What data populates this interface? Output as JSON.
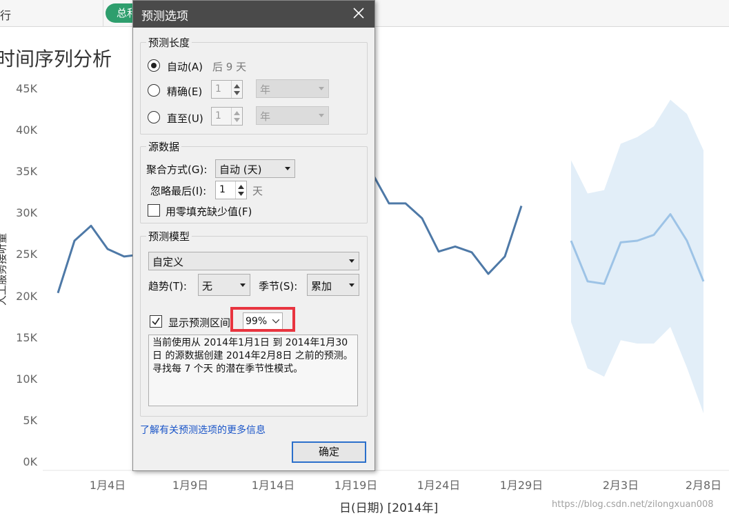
{
  "toolbar": {
    "rows_label": "行",
    "pill_label": "总和"
  },
  "chart_data": {
    "type": "line",
    "title": "时间序列分析",
    "ylabel": "人工服务接听量",
    "xlabel": "日(日期) [2014年]",
    "ylim": [
      0,
      45000
    ],
    "yticks": [
      "0K",
      "5K",
      "10K",
      "15K",
      "20K",
      "25K",
      "30K",
      "35K",
      "40K",
      "45K"
    ],
    "xticks": [
      {
        "label": "1月4日",
        "day": 4
      },
      {
        "label": "1月9日",
        "day": 9
      },
      {
        "label": "1月14日",
        "day": 14
      },
      {
        "label": "1月19日",
        "day": 19
      },
      {
        "label": "1月24日",
        "day": 24
      },
      {
        "label": "1月29日",
        "day": 29
      },
      {
        "label": "2月3日",
        "day": 35
      },
      {
        "label": "2月8日",
        "day": 40
      }
    ],
    "series": [
      {
        "role": "actual",
        "color": "#4e79a7",
        "points": [
          {
            "day": 1,
            "value": 20400
          },
          {
            "day": 2,
            "value": 26700
          },
          {
            "day": 3,
            "value": 28500
          },
          {
            "day": 4,
            "value": 25700
          },
          {
            "day": 5,
            "value": 24800
          },
          {
            "day": 18,
            "value": 28000
          },
          {
            "day": 19,
            "value": 36400
          },
          {
            "day": 20,
            "value": 34800
          },
          {
            "day": 21,
            "value": 31200
          },
          {
            "day": 22,
            "value": 31200
          },
          {
            "day": 23,
            "value": 29400
          },
          {
            "day": 24,
            "value": 25400
          },
          {
            "day": 25,
            "value": 26000
          },
          {
            "day": 26,
            "value": 25300
          },
          {
            "day": 27,
            "value": 22700
          },
          {
            "day": 28,
            "value": 24800
          },
          {
            "day": 29,
            "value": 30900
          }
        ]
      },
      {
        "role": "forecast",
        "color": "#9dc3e6",
        "points": [
          {
            "day": 32,
            "value": 26700
          },
          {
            "day": 33,
            "value": 21800
          },
          {
            "day": 34,
            "value": 21500
          },
          {
            "day": 35,
            "value": 26500
          },
          {
            "day": 36,
            "value": 26700
          },
          {
            "day": 37,
            "value": 27400
          },
          {
            "day": 38,
            "value": 29900
          },
          {
            "day": 39,
            "value": 26700
          },
          {
            "day": 40,
            "value": 21800
          }
        ]
      }
    ],
    "band": {
      "color": "#e2eef8",
      "upper": [
        36400,
        32400,
        32800,
        38400,
        39200,
        40500,
        43700,
        42000,
        37600
      ],
      "lower": [
        16900,
        11300,
        10300,
        14700,
        14300,
        14300,
        16300,
        11400,
        5900
      ]
    }
  },
  "watermark": "https://blog.csdn.net/zilongxuan008",
  "dialog": {
    "title": "预测选项",
    "forecast_length": {
      "group_label": "预测长度",
      "auto_label": "自动(A)",
      "auto_hint": "后 9 天",
      "exact_label": "精确(E)",
      "exact_value": "1",
      "exact_unit": "年",
      "until_label": "直至(U)",
      "until_value": "1",
      "until_unit": "年"
    },
    "source": {
      "group_label": "源数据",
      "aggregate_label": "聚合方式(G):",
      "aggregate_value": "自动 (天)",
      "ignore_label": "忽略最后(I):",
      "ignore_value": "1",
      "ignore_unit": "天",
      "fill_zero_label": "用零填充缺少值(F)"
    },
    "model": {
      "group_label": "预测模型",
      "model_value": "自定义",
      "trend_label": "趋势(T):",
      "trend_value": "无",
      "season_label": "季节(S):",
      "season_value": "累加",
      "show_interval_label": "显示预测区间",
      "interval_value": "99%",
      "description": "当前使用从 2014年1月1日 到 2014年1月30日 的源数据创建 2014年2月8日 之前的预测。 寻找每 7 个天 的潜在季节性模式。"
    },
    "learn_more": "了解有关预测选项的更多信息",
    "ok_label": "确定"
  }
}
